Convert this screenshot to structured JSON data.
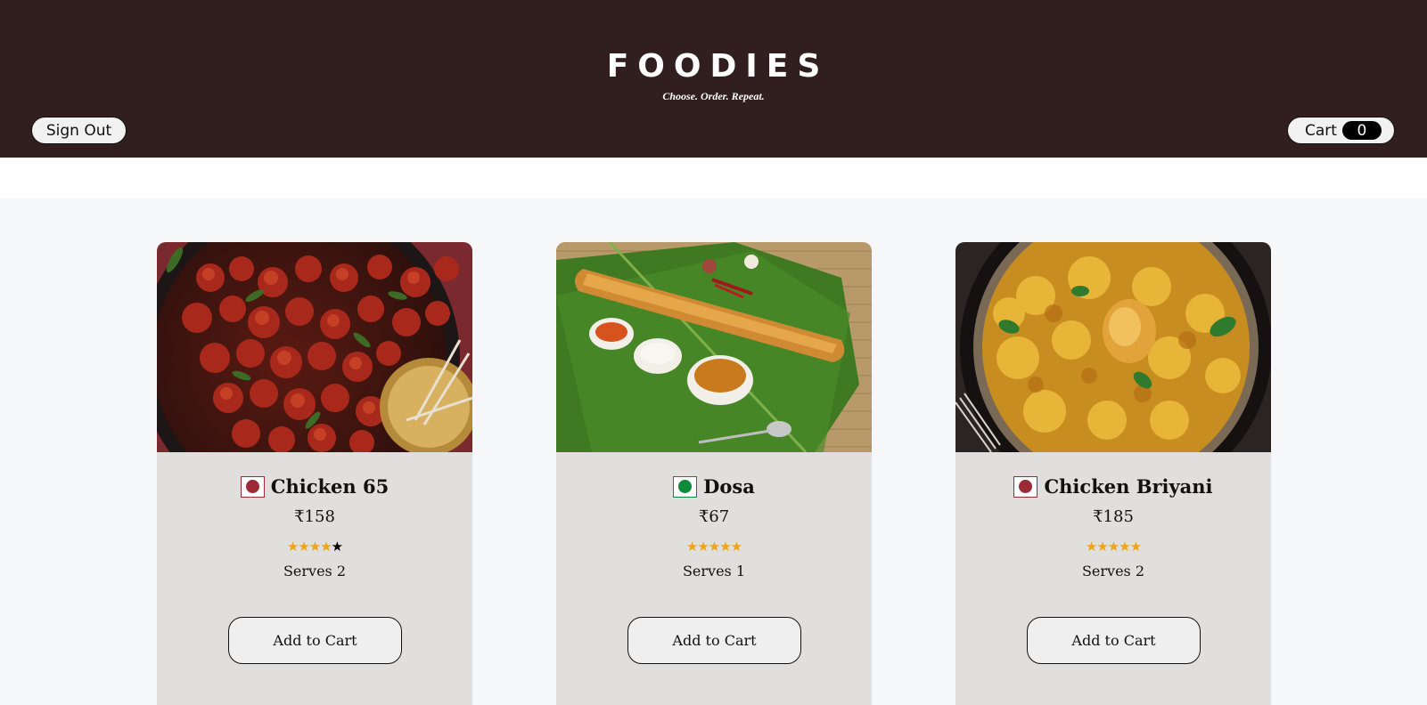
{
  "header": {
    "brand": "FOODIES",
    "tagline": "Choose. Order. Repeat.",
    "sign_out_label": "Sign Out",
    "cart_label": "Cart",
    "cart_count": "0"
  },
  "colors": {
    "header_bg": "#311f20",
    "card_bg": "#e0dfdd",
    "page_bg": "#f6f7f9",
    "star_color": "#f0a316",
    "non_veg": "#9b2b36",
    "veg": "#0a8a3a"
  },
  "items": [
    {
      "name": "Chicken 65",
      "price": "₹158",
      "rating": 4,
      "rating_max": 5,
      "serves": "Serves 2",
      "diet": "non-veg",
      "image": "chicken-65-photo",
      "button_label": "Add to Cart"
    },
    {
      "name": "Dosa",
      "price": "₹67",
      "rating": 5,
      "rating_max": 5,
      "serves": "Serves 1",
      "diet": "veg",
      "image": "dosa-photo",
      "button_label": "Add to Cart"
    },
    {
      "name": "Chicken Briyani",
      "price": "₹185",
      "rating": 5,
      "rating_max": 5,
      "serves": "Serves 2",
      "diet": "non-veg",
      "image": "chicken-briyani-photo",
      "button_label": "Add to Cart"
    }
  ]
}
